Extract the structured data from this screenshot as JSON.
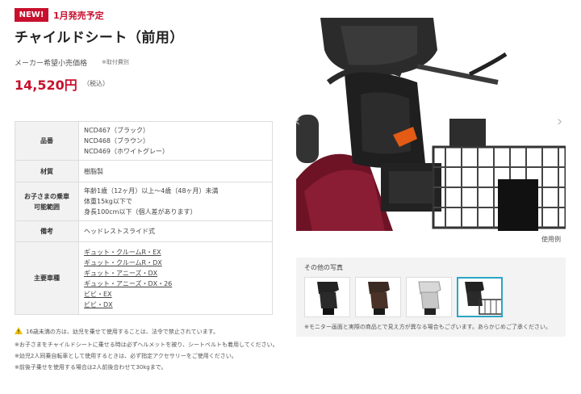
{
  "header": {
    "badge": "NEW!",
    "release": "1月発売予定",
    "title": "チャイルドシート（前用）"
  },
  "price": {
    "label": "メーカー希望小売価格",
    "note": "※取付費別",
    "value": "14,520円",
    "tax": "（税込）"
  },
  "spec": {
    "rows": [
      {
        "label": "品番",
        "lines": [
          "NCD467（ブラック）",
          "NCD468（ブラウン）",
          "NCD469（ホワイトグレー）"
        ]
      },
      {
        "label": "材質",
        "lines": [
          "樹脂製"
        ]
      },
      {
        "label": "お子さまの乗車可能範囲",
        "lines": [
          "年齢1歳（12ヶ月）以上～4歳（48ヶ月）未満",
          "体重15kg以下で",
          "身長100cm以下（個人差があります）"
        ]
      },
      {
        "label": "備考",
        "lines": [
          "ヘッドレストスライド式"
        ]
      },
      {
        "label": "主要車種",
        "links": [
          "ギュット・クルームR・EX",
          "ギュット・クルームR・DX",
          "ギュット・アニーズ・DX",
          "ギュット・アニーズ・DX・26",
          "ビビ・EX",
          "ビビ・DX"
        ]
      }
    ]
  },
  "notices": {
    "warning": "16歳未満の方は、幼児を乗せて使用することは、法令で禁止されています。",
    "items": [
      "※お子さまをチャイルドシートに乗せる時は必ずヘルメットを被り、シートベルトも着用してください。",
      "※幼児2人同乗自転車として使用するときは、必ず指定アクセサリーをご使用ください。",
      "※前後子乗せを使用する場合は2人前後合わせて30kgまで。"
    ]
  },
  "gallery": {
    "caption": "使用例",
    "other_title": "その他の写真",
    "other_note": "※モニター画面と実際の商品とで見え方が異なる場合もございます。あらかじめご了承ください。",
    "arrow_left": "‹",
    "arrow_right": "›"
  },
  "colors": {
    "accent_red": "#c8102e",
    "thumb_active_border": "#2aa5c6",
    "table_header_bg": "#f2f2f2"
  }
}
